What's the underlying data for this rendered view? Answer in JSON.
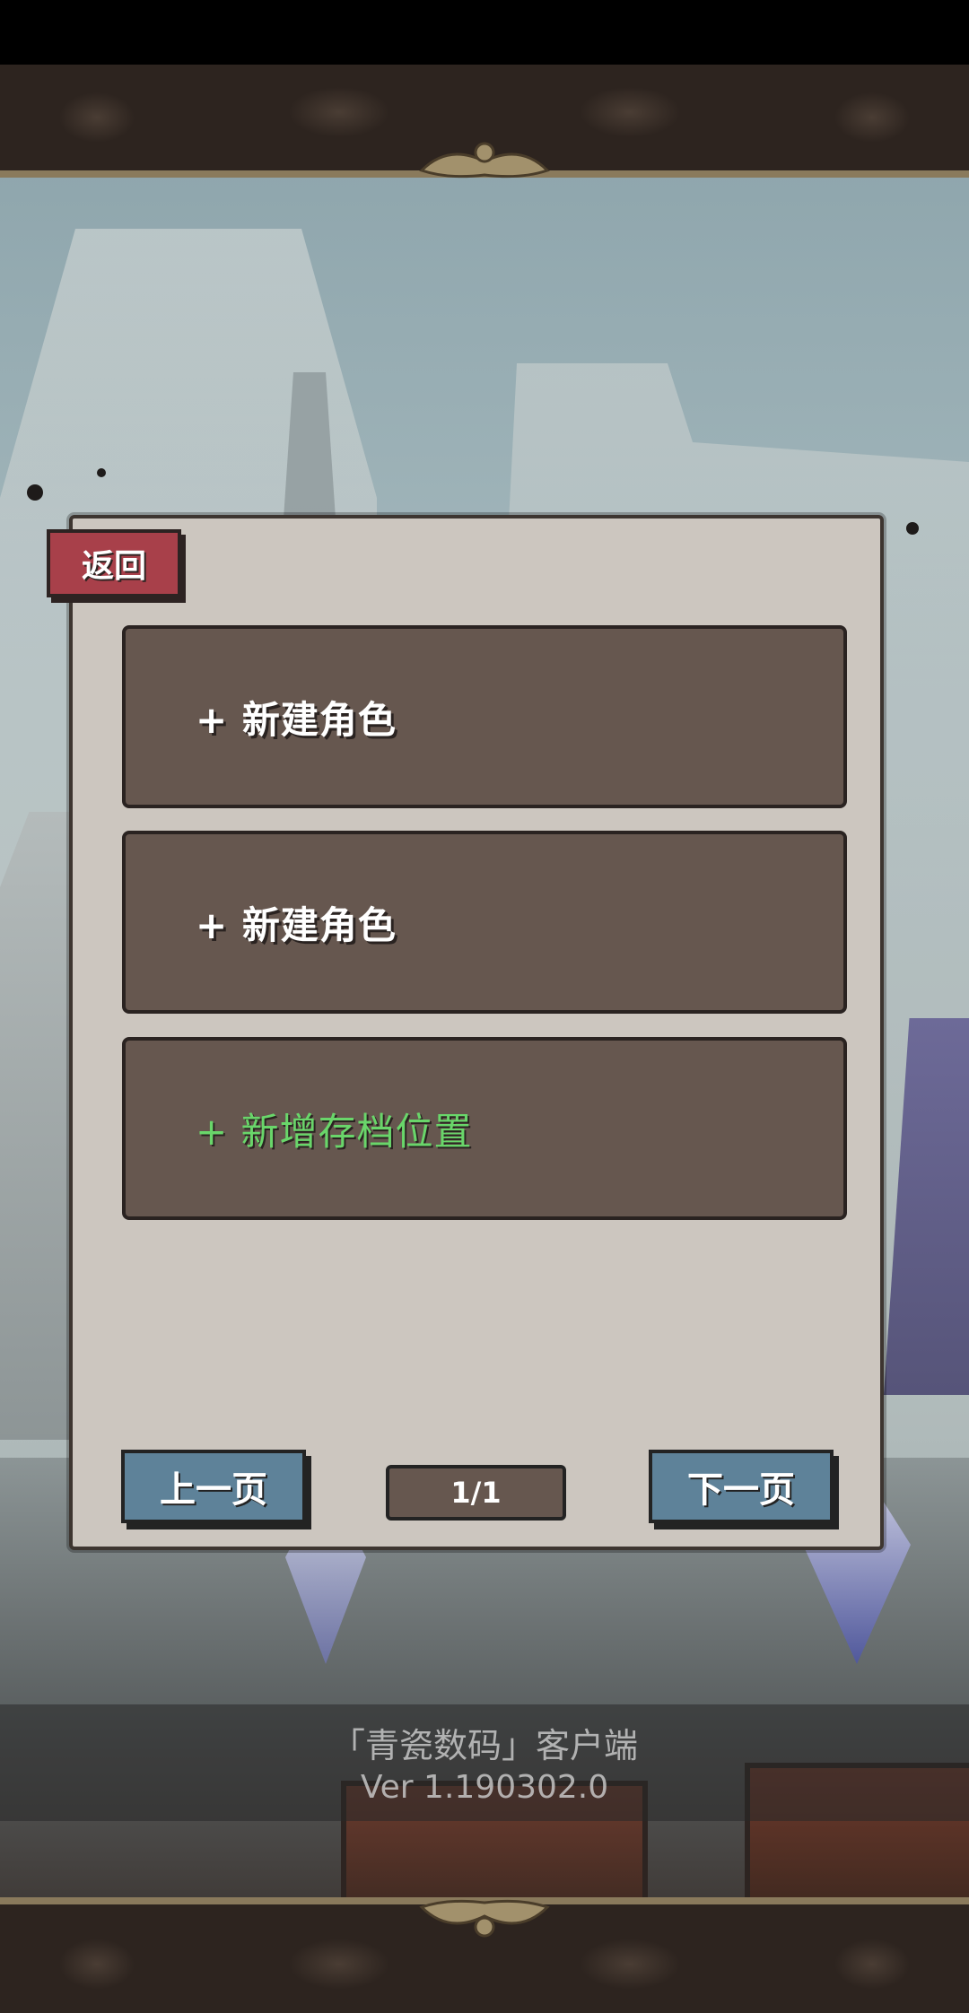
{
  "dialog": {
    "back_label": "返回",
    "slots": [
      {
        "label": "+ 新建角色",
        "type": "new-character"
      },
      {
        "label": "+ 新建角色",
        "type": "new-character"
      },
      {
        "label": "+ 新增存档位置",
        "type": "add-save-slot"
      }
    ],
    "pagination": {
      "prev_label": "上一页",
      "page_text": "1/1",
      "next_label": "下一页"
    }
  },
  "footer": {
    "app_title": "「青瓷数码」客户端",
    "version": "Ver 1.190302.0"
  },
  "colors": {
    "dialog_bg": "#ccc6bf",
    "slot_bg": "#66574f",
    "back_button": "#a8404a",
    "page_button": "#5e8299",
    "add_slot_text": "#69d66a"
  }
}
